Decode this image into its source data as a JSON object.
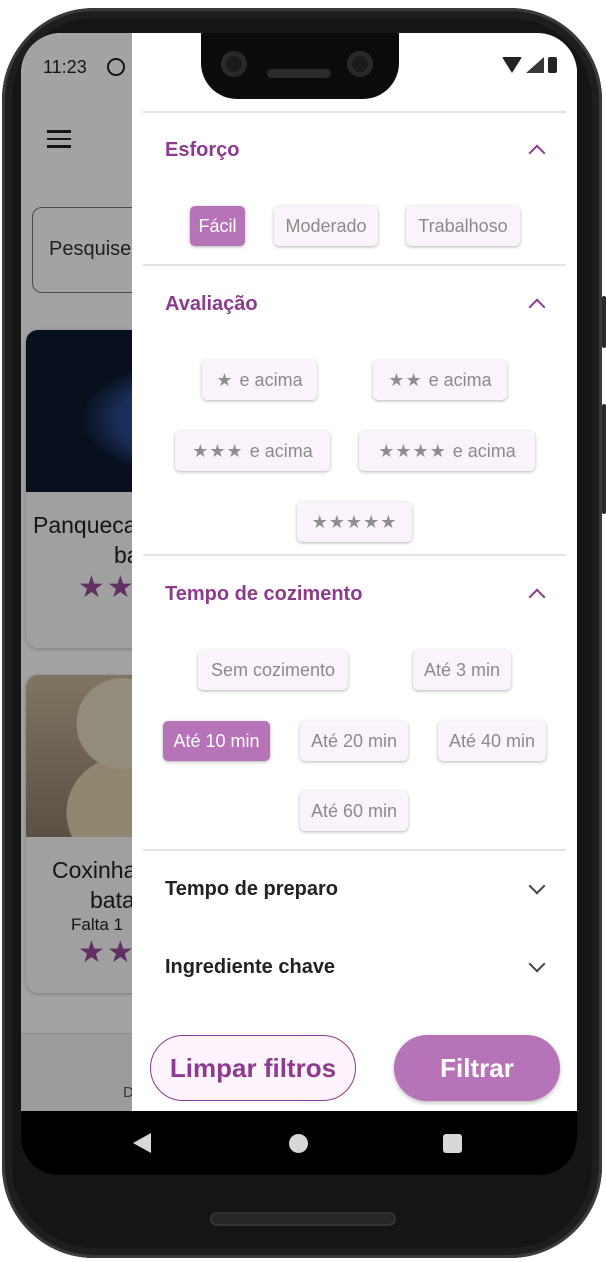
{
  "status_bar": {
    "time": "11:23"
  },
  "background": {
    "search_placeholder": "Pesquise",
    "cards": [
      {
        "title_line1": "Panqueca",
        "title_line2": "ba",
        "stars": "★★"
      },
      {
        "title_line1": "Coxinha",
        "title_line2": "bata",
        "subtitle": "Falta 1",
        "stars": "★★"
      }
    ],
    "bottom_label": "D"
  },
  "drawer": {
    "effort": {
      "title": "Esforço",
      "chips": [
        "Fácil",
        "Moderado",
        "Trabalhoso"
      ],
      "selected": "Fácil"
    },
    "rating": {
      "title": "Avaliação",
      "suffix": "e acima",
      "chips": [
        {
          "stars": "★",
          "label": "e acima"
        },
        {
          "stars": "★★",
          "label": "e acima"
        },
        {
          "stars": "★★★",
          "label": "e acima"
        },
        {
          "stars": "★★★★",
          "label": "e acima"
        },
        {
          "stars": "★★★★★",
          "label": ""
        }
      ]
    },
    "cook_time": {
      "title": "Tempo de cozimento",
      "chips": [
        "Sem cozimento",
        "Até 3 min",
        "Até 10 min",
        "Até 20 min",
        "Até 40 min",
        "Até 60 min"
      ],
      "selected": "Até 10 min"
    },
    "prep_time": {
      "title": "Tempo de preparo"
    },
    "key_ingredient": {
      "title": "Ingrediente chave"
    },
    "buttons": {
      "clear": "Limpar filtros",
      "filter": "Filtrar"
    }
  },
  "colors": {
    "accent": "#8d3a8f",
    "chip_selected": "#b773b8",
    "chip_bg": "#fbf3fb"
  }
}
